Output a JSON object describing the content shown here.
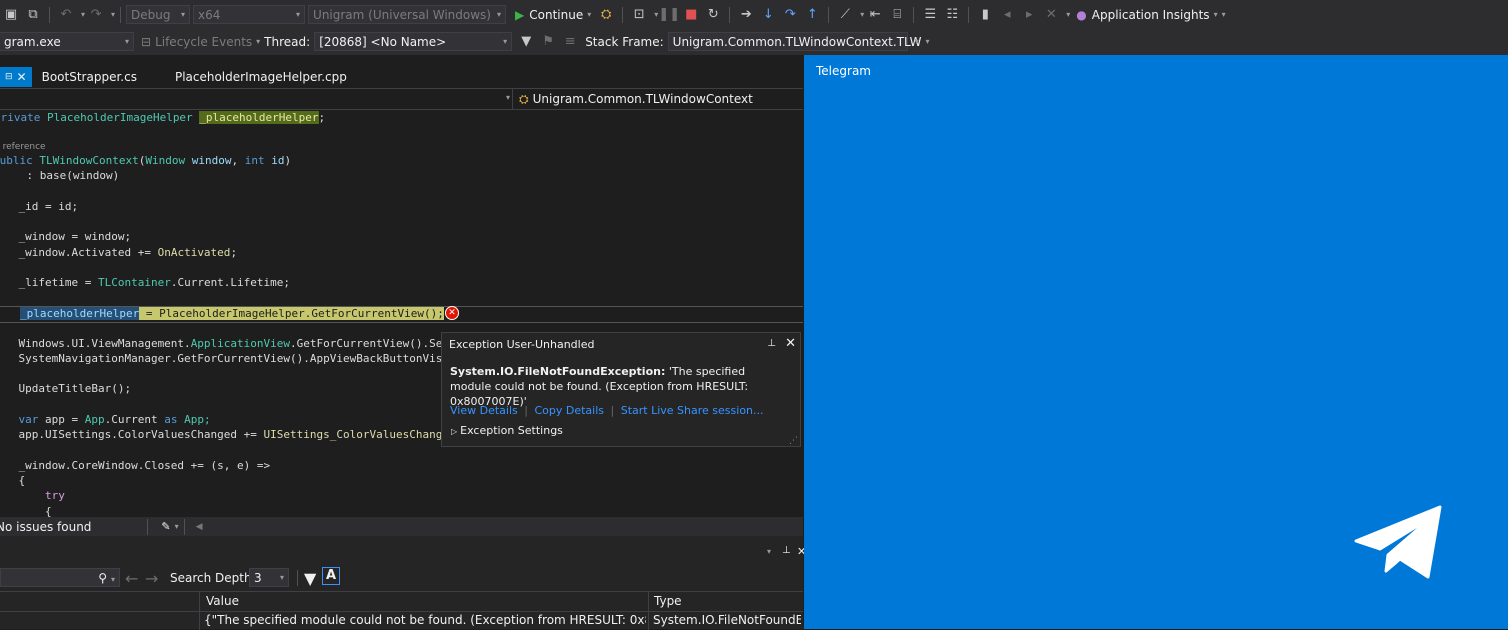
{
  "toolbar": {
    "config": "Debug",
    "platform": "x64",
    "startup_project": "Unigram (Universal Windows)",
    "continue_label": "Continue",
    "app_insights_label": "Application Insights",
    "process": "gram.exe",
    "lifecycle_label": "Lifecycle Events",
    "thread_label": "Thread:",
    "thread_value": "[20868] <No Name>",
    "stack_frame_label": "Stack Frame:",
    "stack_frame_value": "Unigram.Common.TLWindowContext.TLW"
  },
  "tabs": [
    {
      "label": "BootStrapper.cs"
    },
    {
      "label": "PlaceholderImageHelper.cpp"
    }
  ],
  "nav": {
    "member": "Unigram.Common.TLWindowContext"
  },
  "code": {
    "ref_hint": "1 reference",
    "l1_kw": "private",
    "l1_type": "PlaceholderImageHelper",
    "l1_field": "_placeholderHelper",
    "l1_end": ";",
    "l2_kw": "public",
    "l2_name": "TLWindowContext",
    "l2_type1": "Window",
    "l2_p1": "window",
    "l2_kw2": "int",
    "l2_p2": "id",
    "l2_open": "(",
    "l2_comma": ", ",
    "l2_close": ")",
    "l3": "    : base(window)",
    "l4": "{",
    "l5": "    _id = id;",
    "l6": "    _window = window;",
    "l7a": "    _window.Activated += ",
    "l7b": "OnActivated",
    "l7c": ";",
    "l8a": "    _lifetime = ",
    "l8b": "TLContainer",
    "l8c": ".Current.Lifetime;",
    "l9a": "_placeholderHelper",
    "l9b": " = PlaceholderImageHelper.GetForCurrentView();",
    "l10a": "    Windows.UI.ViewManagement.",
    "l10b": "ApplicationView",
    "l10c": ".GetForCurrentView().Set",
    "l11": "    SystemNavigationManager.GetForCurrentView().AppViewBackButtonVisi",
    "l12": "    UpdateTitleBar();",
    "l13a": "    var",
    "l13b": " app = ",
    "l13c": "App",
    "l13d": ".Current ",
    "l13e": "as",
    "l13f": " App;",
    "l14a": "    app.UISettings.ColorValuesChanged += ",
    "l14b": "UISettings_ColorValuesChange",
    "l15": "    _window.CoreWindow.Closed += (s, e) =>",
    "l16": "    {",
    "l17": "        try",
    "l18": "        {"
  },
  "exception": {
    "title": "Exception User-Unhandled",
    "type": "System.IO.FileNotFoundException:",
    "message": " 'The specified module could not be found. (Exception from HRESULT: 0x8007007E)'",
    "link_view": "View Details",
    "link_copy": "Copy Details",
    "link_share": "Start Live Share session...",
    "settings": "Exception Settings"
  },
  "status": {
    "issues": "No issues found"
  },
  "panel": {
    "search_depth_label": "Search Depth:",
    "search_depth_value": "3",
    "col_value": "Value",
    "col_type": "Type",
    "row_value": "{\"The specified module could not be found. (Exception from HRESULT: 0x8007007E...",
    "row_type": "System.IO.FileNotFoundE..."
  },
  "telegram": {
    "title": "Telegram",
    "bg": "#0078d7"
  }
}
